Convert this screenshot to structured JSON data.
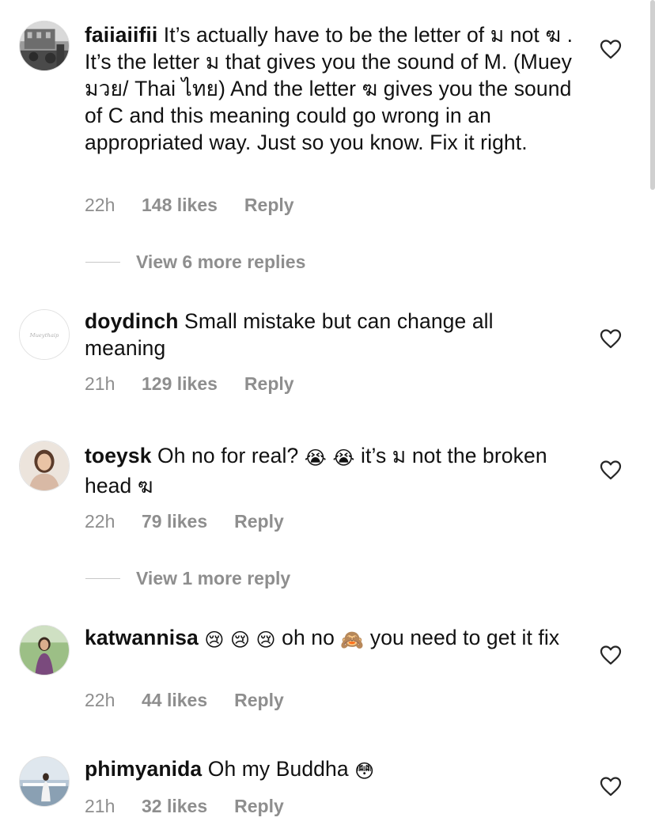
{
  "comments": [
    {
      "username": "faiiaiifii",
      "text": " It’s actually have to be the letter of ม not ฆ . It’s the letter ม that gives you the sound of M. (Muey มวย/ Thai ไทย) And the letter ฆ gives you the sound of C and this meaning could go wrong in an appropriated way. Just so you know. Fix it right.",
      "time": "22h",
      "likes": "148 likes",
      "reply": "Reply"
    },
    {
      "username": "doydinch",
      "text": " Small mistake but can change all meaning",
      "time": "21h",
      "likes": "129 likes",
      "reply": "Reply",
      "avatar_text": "Muey thaip"
    },
    {
      "username": "toeysk",
      "text_before": " Oh no for real? ",
      "emoji_1": "😭",
      "emoji_2": "😭",
      "text_after": " it’s ม not the broken head ฆ",
      "time": "22h",
      "likes": "79 likes",
      "reply": "Reply"
    },
    {
      "username": "katwannisa",
      "emoji_1": "😢",
      "emoji_2": "😢",
      "emoji_3": "😢",
      "text_mid": " oh no ",
      "emoji_4": "🙈",
      "text_after": " you need to get it fix",
      "time": "22h",
      "likes": "44 likes",
      "reply": "Reply"
    },
    {
      "username": "phimyanida",
      "text": " Oh my Buddha ",
      "emoji_1": "😳",
      "time": "21h",
      "likes": "32 likes",
      "reply": "Reply"
    }
  ],
  "view_more": [
    "View 6 more replies",
    "View 1 more reply"
  ],
  "icons": {
    "like": "heart-icon"
  },
  "colors": {
    "text": "#111111",
    "muted": "#8e8e8e",
    "divider": "#c7c7c7"
  }
}
